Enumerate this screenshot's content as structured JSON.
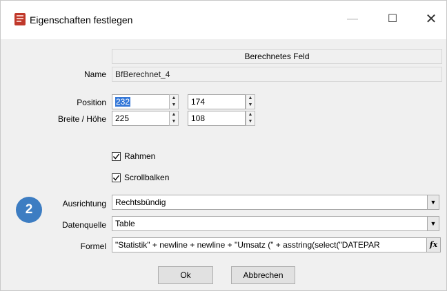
{
  "window": {
    "title": "Eigenschaften festlegen",
    "icons": {
      "app": "app-icon",
      "minimize": "minimize-icon",
      "maximize": "maximize-icon",
      "close": "close-icon"
    },
    "minimize_glyph": "—",
    "maximize_glyph": "☐",
    "close_glyph": "✕"
  },
  "header": {
    "label": "Berechnetes Feld"
  },
  "form": {
    "name": {
      "label": "Name",
      "value": "BfBerechnet_4"
    },
    "position": {
      "label": "Position",
      "x": "232",
      "y": "174"
    },
    "size": {
      "label": "Breite / Höhe",
      "width": "225",
      "height": "108"
    },
    "rahmen": {
      "label": "Rahmen",
      "checked": true
    },
    "scrollbalken": {
      "label": "Scrollbalken",
      "checked": true
    },
    "ausrichtung": {
      "label": "Ausrichtung",
      "value": "Rechtsbündig"
    },
    "datenquelle": {
      "label": "Datenquelle",
      "value": "Table"
    },
    "formel": {
      "label": "Formel",
      "value": "\"Statistik\" + newline + newline + \"Umsatz (\" +  asstring(select(\"DATEPAR"
    }
  },
  "badge": {
    "number": "2",
    "color": "#3d7dc2"
  },
  "buttons": {
    "ok": "Ok",
    "cancel": "Abbrechen"
  },
  "colors": {
    "selection": "#3578d8"
  }
}
